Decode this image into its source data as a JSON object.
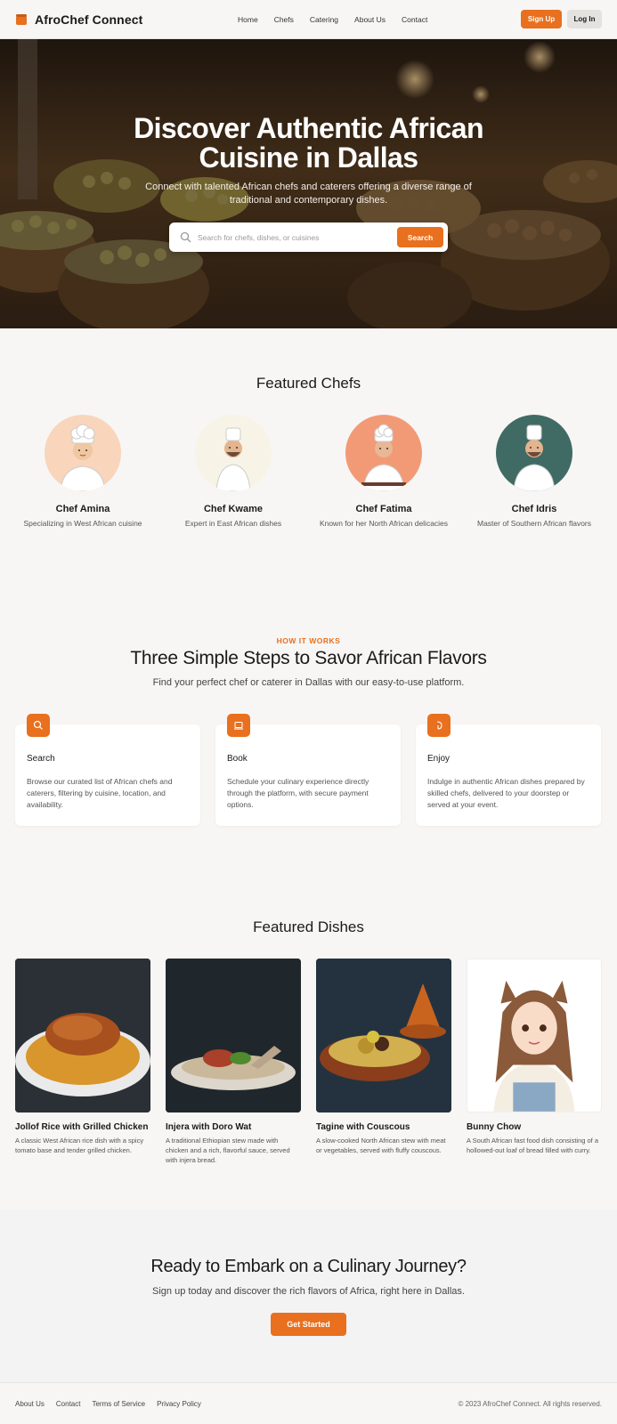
{
  "header": {
    "brand": "AfroChef Connect",
    "nav": [
      "Home",
      "Chefs",
      "Catering",
      "About Us",
      "Contact"
    ],
    "signup_label": "Sign Up",
    "login_label": "Log In"
  },
  "hero": {
    "title_line1": "Discover Authentic African",
    "title_line2": "Cuisine in Dallas",
    "subtitle": "Connect with talented African chefs and caterers offering a diverse range of traditional and contemporary dishes.",
    "search_placeholder": "Search for chefs, dishes, or cuisines",
    "search_button": "Search"
  },
  "featured_chefs": {
    "title": "Featured Chefs",
    "chefs": [
      {
        "name": "Chef Amina",
        "desc": "Specializing in West African cuisine",
        "bg": "#f9d5bc"
      },
      {
        "name": "Chef Kwame",
        "desc": "Expert in East African dishes",
        "bg": "#f7f3e6"
      },
      {
        "name": "Chef Fatima",
        "desc": "Known for her North African delicacies",
        "bg": "#f29a76"
      },
      {
        "name": "Chef Idris",
        "desc": "Master of Southern African flavors",
        "bg": "#3f6b64"
      }
    ]
  },
  "how_it_works": {
    "label": "HOW IT WORKS",
    "title": "Three Simple Steps to Savor African Flavors",
    "subtitle": "Find your perfect chef or caterer in Dallas with our easy-to-use platform.",
    "steps": [
      {
        "title": "Search",
        "desc": "Browse our curated list of African chefs and caterers, filtering by cuisine, location, and availability.",
        "icon": "search-icon"
      },
      {
        "title": "Book",
        "desc": "Schedule your culinary experience directly through the platform, with secure payment options.",
        "icon": "laptop-icon"
      },
      {
        "title": "Enjoy",
        "desc": "Indulge in authentic African dishes prepared by skilled chefs, delivered to your doorstep or served at your event.",
        "icon": "utensil-icon"
      }
    ]
  },
  "featured_dishes": {
    "title": "Featured Dishes",
    "dishes": [
      {
        "name": "Jollof Rice with Grilled Chicken",
        "desc": "A classic West African rice dish with a spicy tomato base and tender grilled chicken."
      },
      {
        "name": "Injera with Doro Wat",
        "desc": "A traditional Ethiopian stew made with chicken and a rich, flavorful sauce, served with injera bread."
      },
      {
        "name": "Tagine with Couscous",
        "desc": "A slow-cooked North African stew with meat or vegetables, served with fluffy couscous."
      },
      {
        "name": "Bunny Chow",
        "desc": "A South African fast food dish consisting of a hollowed-out loaf of bread filled with curry."
      }
    ]
  },
  "cta": {
    "title": "Ready to Embark on a Culinary Journey?",
    "subtitle": "Sign up today and discover the rich flavors of Africa, right here in Dallas.",
    "button": "Get Started"
  },
  "footer": {
    "links": [
      "About Us",
      "Contact",
      "Terms of Service",
      "Privacy Policy"
    ],
    "copyright": "© 2023 AfroChef Connect. All rights reserved."
  },
  "colors": {
    "accent": "#e8701f",
    "background": "#f7f6f4"
  }
}
